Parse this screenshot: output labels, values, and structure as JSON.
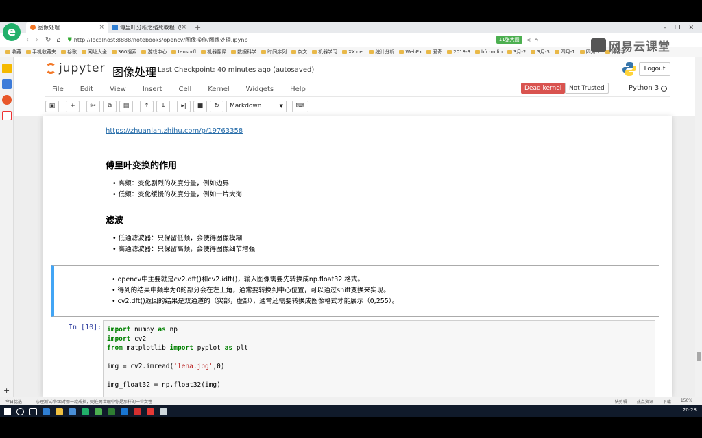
{
  "browser": {
    "tabs": [
      {
        "label": "图像处理",
        "active": true
      },
      {
        "label": "傅里叶分析之掐死教程（完整版",
        "active": false
      }
    ],
    "url": "http://localhost:8888/notebooks/opencv/图像操作/图像处理.ipynb",
    "badge": "11张大图",
    "bookmarks": [
      "收藏",
      "手机收藏夹",
      "谷歌",
      "网址大全",
      "360搜索",
      "游戏中心",
      "tensorfl",
      "机器翻译",
      "数据科学",
      "时间序列",
      "杂文",
      "机器学习",
      "XX.net",
      "统计分析",
      "WebEx",
      "爱奇",
      "2018-3",
      "bfcrm.lib",
      "3月-2",
      "3月-3",
      "四月-1",
      "四月-2",
      "博客学"
    ],
    "watermark": "网易云课堂"
  },
  "jupyter": {
    "logo": "jupyter",
    "notebook_title": "图像处理",
    "checkpoint": "Last Checkpoint: 40 minutes ago (autosaved)",
    "logout": "Logout",
    "menu": [
      "File",
      "Edit",
      "View",
      "Insert",
      "Cell",
      "Kernel",
      "Widgets",
      "Help"
    ],
    "dead_kernel": "Dead kernel",
    "not_trusted": "Not Trusted",
    "kernel_name": "Python 3",
    "cell_type": "Markdown"
  },
  "notebook": {
    "link": "https://zhuanlan.zhihu.com/p/19763358",
    "section1": {
      "title": "傅里叶变换的作用",
      "items": [
        "高频：变化剧烈的灰度分量，例如边界",
        "低频：变化缓慢的灰度分量，例如一片大海"
      ]
    },
    "section2": {
      "title": "滤波",
      "items": [
        "低通滤波器：只保留低频，会使得图像模糊",
        "高通滤波器：只保留高频，会使得图像细节增强"
      ]
    },
    "md_cell": {
      "items": [
        "opencv中主要就是cv2.dft()和cv2.idft()，输入图像需要先转换成np.float32 格式。",
        "得到的结果中频率为0的部分会在左上角，通常要转换到中心位置，可以通过shift变换来实现。",
        "cv2.dft()返回的结果是双通道的（实部，虚部），通常还需要转换成图像格式才能展示（0,255）。"
      ]
    },
    "code_cell": {
      "prompt": "In [10]:",
      "l1_kw": "import",
      "l1_rest": " numpy ",
      "l1_kw2": "as",
      "l1_rest2": " np",
      "l2_kw": "import",
      "l2_rest": " cv2",
      "l3_kw": "from",
      "l3_rest": " matplotlib ",
      "l3_kw2": "import",
      "l3_rest2": " pyplot ",
      "l3_kw3": "as",
      "l3_rest3": " plt",
      "l4_a": "img = cv2.imread(",
      "l4_str": "'lena.jpg'",
      "l4_b": ",0)",
      "l5": "img_float32 = np.float32(img)"
    }
  },
  "statusbar": {
    "left": "今日优选",
    "news": "心理测试:你面对哪一款戒指，则在男士眼中你是那样的一个女性",
    "right": [
      "快剪辑",
      "热点资讯",
      "下载",
      "150%"
    ]
  },
  "taskbar": {
    "time": "20:28"
  }
}
